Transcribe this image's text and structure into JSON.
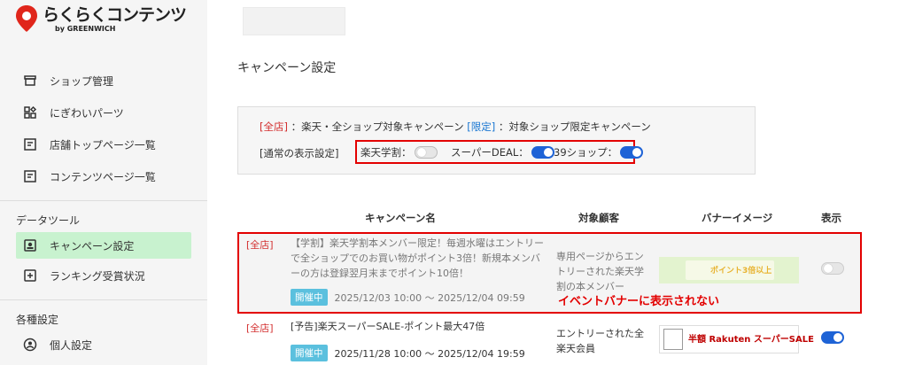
{
  "logo": {
    "main": "らくらくコンテンツ",
    "sub": "by GREENWICH"
  },
  "sidebar": {
    "items": [
      {
        "label": "ショップ管理",
        "icon": "store-icon"
      },
      {
        "label": "にぎわいパーツ",
        "icon": "parts-icon"
      },
      {
        "label": "店舗トップページ一覧",
        "icon": "page-icon"
      },
      {
        "label": "コンテンツページ一覧",
        "icon": "page-icon"
      }
    ],
    "section_data_tools": "データツール",
    "data_items": [
      {
        "label": "キャンペーン設定",
        "icon": "campaign-icon",
        "active": true
      },
      {
        "label": "ランキング受賞状況",
        "icon": "ranking-icon",
        "active": false
      }
    ],
    "section_settings": "各種設定",
    "settings_items": [
      {
        "label": "個人設定",
        "icon": "person-icon"
      }
    ]
  },
  "page": {
    "title": "キャンペーン設定"
  },
  "legend": {
    "all_tag": "[全店]",
    "all_desc": "：楽天・全ショップ対象キャンペーン",
    "limited_tag": "[限定]",
    "limited_desc": "：対象ショップ限定キャンペーン",
    "display_setting_label": "[通常の表示設定]",
    "toggles": [
      {
        "label": "楽天学割：",
        "on": false
      },
      {
        "label": "スーパーDEAL：",
        "on": true
      },
      {
        "label": "39ショップ：",
        "on": true
      }
    ]
  },
  "table": {
    "headers": {
      "name": "キャンペーン名",
      "target": "対象顧客",
      "banner": "バナーイメージ",
      "display": "表示"
    },
    "rows": [
      {
        "tag": "[全店]",
        "title": "【学割】楽天学割本メンバー限定！毎週水曜はエントリーで全ショップでのお買い物がポイント3倍！新規本メンバーの方は登録翌月末までポイント10倍！",
        "status": "開催中",
        "period": "2025/12/03 10:00 〜 2025/12/04 09:59",
        "target": "専用ページからエントリーされた楽天学割の本メンバー",
        "banner_text": "ポイント3倍以上",
        "display_on": false,
        "note": "イベントバナーに表示されない"
      },
      {
        "tag": "[全店]",
        "title": "[予告]楽天スーパーSALE-ポイント最大47倍",
        "status": "開催中",
        "period": "2025/11/28 10:00 〜 2025/12/04 19:59",
        "target": "エントリーされた全楽天会員",
        "banner_text": "半額 Rakuten スーパーSALE",
        "display_on": true
      }
    ]
  },
  "colors": {
    "accent_blue": "#1e63d6",
    "highlight_red": "#e30000",
    "active_green": "#c8f2cf",
    "badge_cyan": "#5bc0de"
  }
}
